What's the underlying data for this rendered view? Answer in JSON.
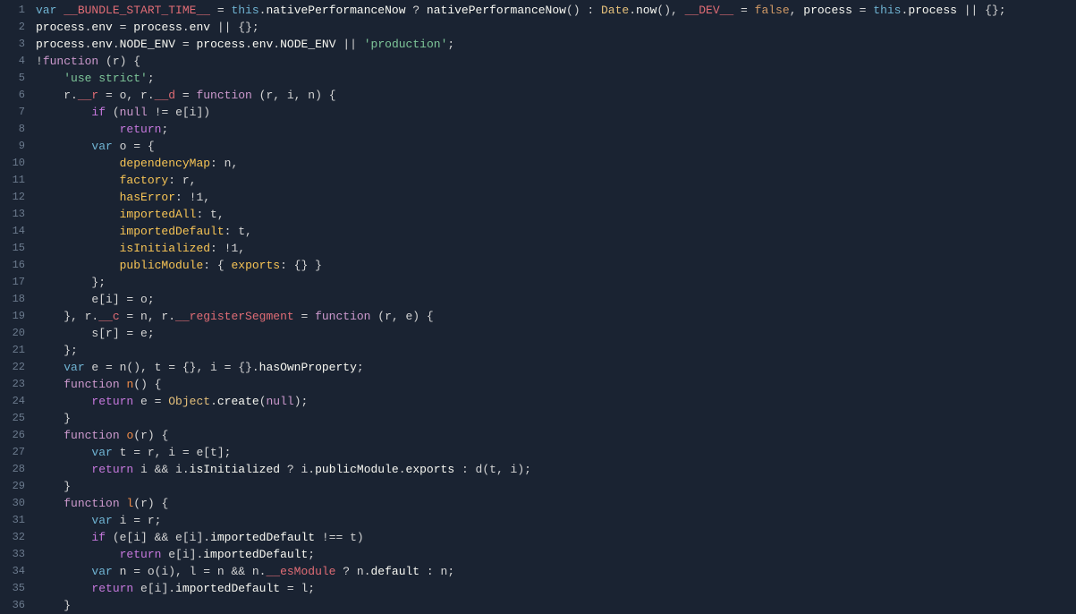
{
  "editor": {
    "background": "#1a2332",
    "lines": [
      {
        "num": 1,
        "content": "var __BUNDLE_START_TIME__ = this.nativePerformanceNow ? nativePerformanceNow() : Date.now(), __DEV__ = false, process = this.process || {};"
      },
      {
        "num": 2,
        "content": "process.env = process.env || {};"
      },
      {
        "num": 3,
        "content": "process.env.NODE_ENV = process.env.NODE_ENV || 'production';"
      },
      {
        "num": 4,
        "content": "!function (r) {"
      },
      {
        "num": 5,
        "content": "    'use strict';"
      },
      {
        "num": 6,
        "content": "    r.__r = o, r.__d = function (r, i, n) {"
      },
      {
        "num": 7,
        "content": "        if (null != e[i])"
      },
      {
        "num": 8,
        "content": "            return;"
      },
      {
        "num": 9,
        "content": "        var o = {"
      },
      {
        "num": 10,
        "content": "            dependencyMap: n,"
      },
      {
        "num": 11,
        "content": "            factory: r,"
      },
      {
        "num": 12,
        "content": "            hasError: !1,"
      },
      {
        "num": 13,
        "content": "            importedAll: t,"
      },
      {
        "num": 14,
        "content": "            importedDefault: t,"
      },
      {
        "num": 15,
        "content": "            isInitialized: !1,"
      },
      {
        "num": 16,
        "content": "            publicModule: { exports: {} }"
      },
      {
        "num": 17,
        "content": "        };"
      },
      {
        "num": 18,
        "content": "        e[i] = o;"
      },
      {
        "num": 19,
        "content": "    }, r.__c = n, r.__registerSegment = function (r, e) {"
      },
      {
        "num": 20,
        "content": "        s[r] = e;"
      },
      {
        "num": 21,
        "content": "    };"
      },
      {
        "num": 22,
        "content": "    var e = n(), t = {}, i = {}.hasOwnProperty;"
      },
      {
        "num": 23,
        "content": "    function n() {"
      },
      {
        "num": 24,
        "content": "        return e = Object.create(null);"
      },
      {
        "num": 25,
        "content": "    }"
      },
      {
        "num": 26,
        "content": "    function o(r) {"
      },
      {
        "num": 27,
        "content": "        var t = r, i = e[t];"
      },
      {
        "num": 28,
        "content": "        return i && i.isInitialized ? i.publicModule.exports : d(t, i);"
      },
      {
        "num": 29,
        "content": "    }"
      },
      {
        "num": 30,
        "content": "    function l(r) {"
      },
      {
        "num": 31,
        "content": "        var i = r;"
      },
      {
        "num": 32,
        "content": "        if (e[i] && e[i].importedDefault !== t)"
      },
      {
        "num": 33,
        "content": "            return e[i].importedDefault;"
      },
      {
        "num": 34,
        "content": "        var n = o(i), l = n && n.__esModule ? n.default : n;"
      },
      {
        "num": 35,
        "content": "        return e[i].importedDefault = l;"
      },
      {
        "num": 36,
        "content": "    }"
      }
    ]
  }
}
